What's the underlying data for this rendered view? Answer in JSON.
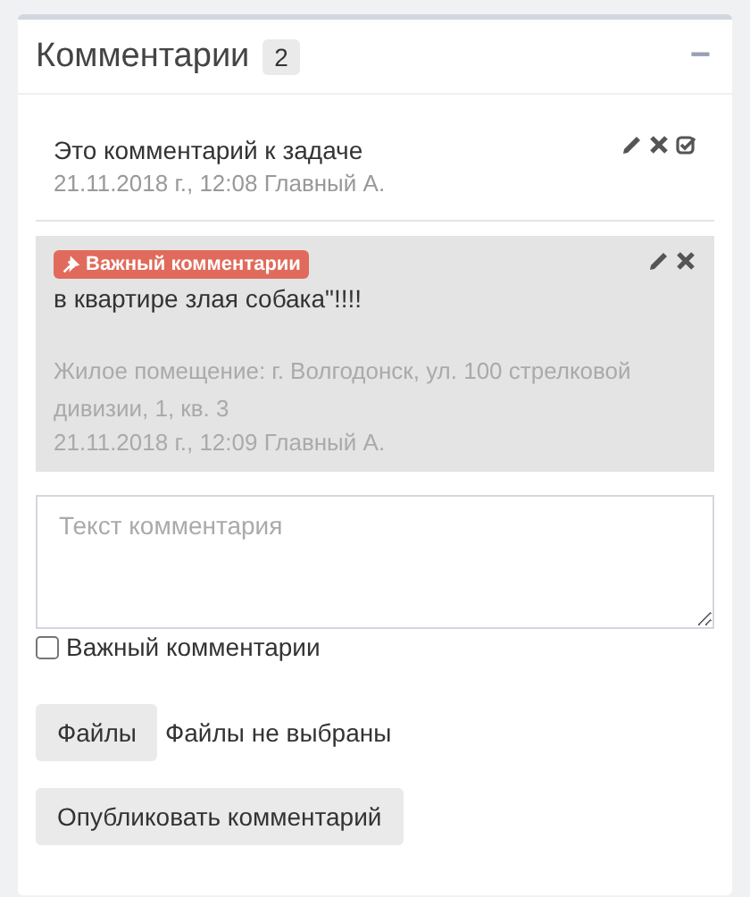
{
  "panel": {
    "title": "Комментарии",
    "count": "2",
    "collapse_symbol": "−"
  },
  "comments": [
    {
      "important": false,
      "resolvable": true,
      "text": "Это комментарий к задаче",
      "meta": "21.11.2018 г., 12:08 Главный А."
    },
    {
      "important": true,
      "resolvable": false,
      "badge": "Важный комментарии",
      "text": "в квартире злая собака\"!!!!",
      "context": "Жилое помещение: г. Волгодонск, ул. 100 стрелковой дивизии, 1, кв. 3",
      "meta": "21.11.2018 г., 12:09 Главный А."
    }
  ],
  "form": {
    "placeholder": "Текст комментария",
    "important_label": "Важный комментарии",
    "important_checked": false,
    "files_button": "Файлы",
    "files_status": "Файлы не выбраны",
    "submit": "Опубликовать комментарий"
  }
}
